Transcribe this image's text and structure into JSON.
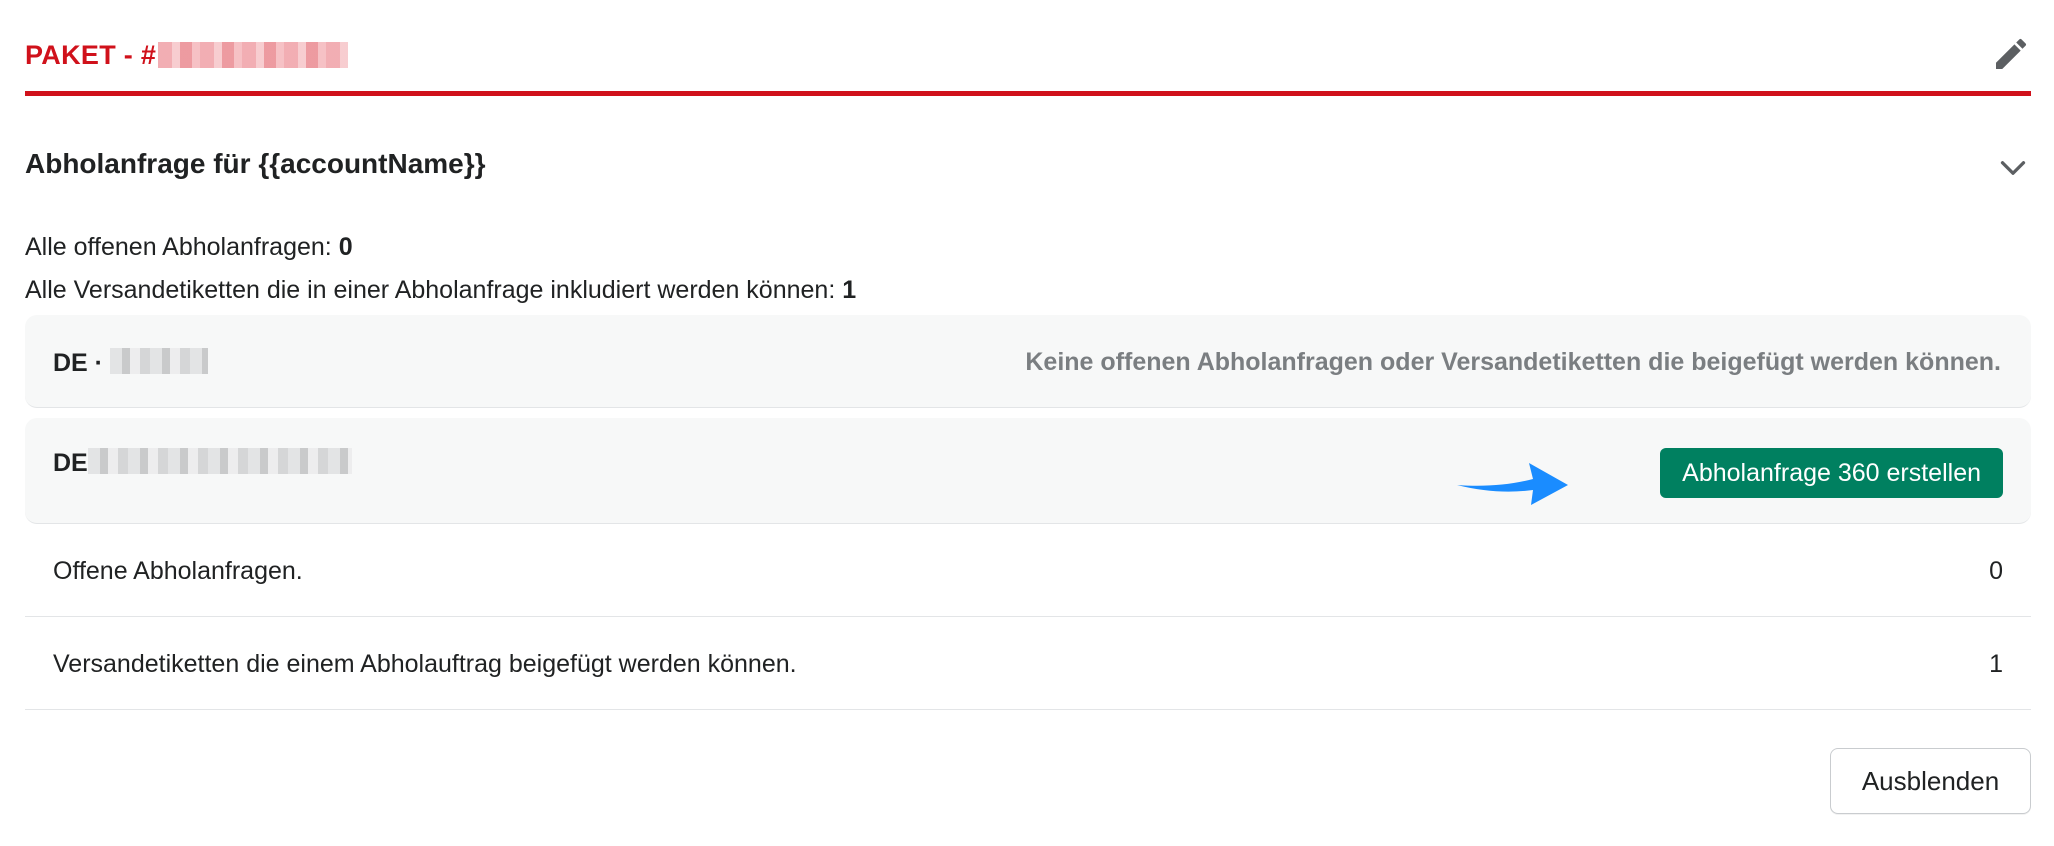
{
  "header": {
    "title": "PAKET - #",
    "edit_icon": "pencil-icon"
  },
  "section": {
    "title": "Abholanfrage für {{accountName}}",
    "collapse_icon": "chevron-down-icon"
  },
  "summary": {
    "open_requests_label": "Alle offenen Abholanfragen:",
    "open_requests_value": "0",
    "labels_label": "Alle Versandetiketten die in einer Abholanfrage inkludiert werden können:",
    "labels_value": "1"
  },
  "accounts": [
    {
      "prefix": "DE ·",
      "message": "Keine offenen Abholanfragen oder Versandetiketten die beigefügt werden können."
    },
    {
      "prefix": "DE",
      "button_label": "Abholanfrage 360 erstellen"
    }
  ],
  "details": [
    {
      "label": "Offene Abholanfragen.",
      "value": "0"
    },
    {
      "label": "Versandetiketten die einem Abholauftrag beigefügt werden können.",
      "value": "1"
    }
  ],
  "footer": {
    "hide_label": "Ausblenden"
  },
  "colors": {
    "brand_red": "#d0111b",
    "primary_green": "#008060",
    "arrow_blue": "#1a8cff"
  }
}
